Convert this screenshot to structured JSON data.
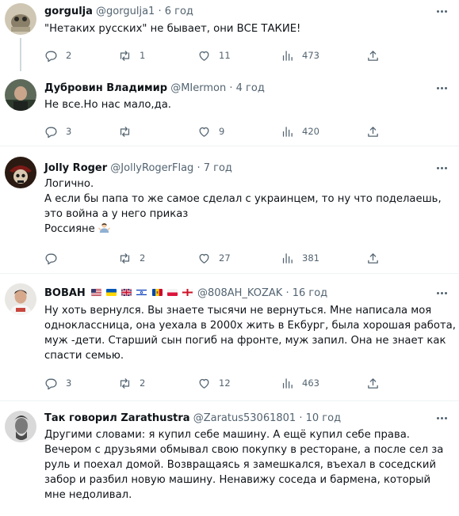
{
  "tweets": [
    {
      "name": "gorgulja",
      "handle": "@gorgulja1",
      "time": "6 год",
      "lines": [
        "\"Нетаких русских\" не бывает, они ВСЕ ТАКИЕ!"
      ],
      "replies": "2",
      "retweets": "1",
      "likes": "11",
      "views": "473"
    },
    {
      "name": "Дубровин Владимир",
      "handle": "@MIermon",
      "time": "4 год",
      "lines": [
        "Не все.Но нас мало,да."
      ],
      "replies": "3",
      "retweets": "",
      "likes": "9",
      "views": "420"
    },
    {
      "name": "Jolly Roger",
      "handle": "@JollyRogerFlag",
      "time": "7 год",
      "lines": [
        "Логично.",
        "А если бы папа то же самое сделал с украинцем, то ну что поделаешь,",
        "это война а у него приказ",
        "Россияне"
      ],
      "replies": "",
      "retweets": "2",
      "likes": "27",
      "views": "381"
    },
    {
      "name": "ВОВАН",
      "handle": "@808AH_KOZAK",
      "time": "16 год",
      "lines": [
        "Ну хоть вернулся. Вы знаете тысячи не вернуться. Мне написала моя",
        "одноклассница, она уехала в 2000х жить в Екбург, была хорошая работа,",
        "муж -дети. Старший сын погиб на фронте, муж запил. Она не знает как",
        "спасти семью."
      ],
      "replies": "3",
      "retweets": "2",
      "likes": "12",
      "views": "463"
    },
    {
      "name": "Так говорил Zarathustra",
      "handle": "@Zaratus53061801",
      "time": "10 год",
      "lines": [
        "Другими словами: я  купил себе машину. А ещё купил себе права.",
        "Вечером с друзьями обмывал свою покупку в ресторане, а после сел за",
        "руль и поехал домой. Возвращаясь я замешкался, въехал в соседский",
        "забор и разбил новую машину. Ненавижу соседа и бармена, который",
        "мне недоливал."
      ]
    }
  ],
  "icons": {
    "reply": "reply-icon",
    "retweet": "retweet-icon",
    "like": "like-icon",
    "views": "views-icon",
    "share": "share-icon",
    "more": "more-icon"
  },
  "colors": {
    "text": "#0f1419",
    "secondary": "#536471",
    "separator": "#eff3f4"
  }
}
